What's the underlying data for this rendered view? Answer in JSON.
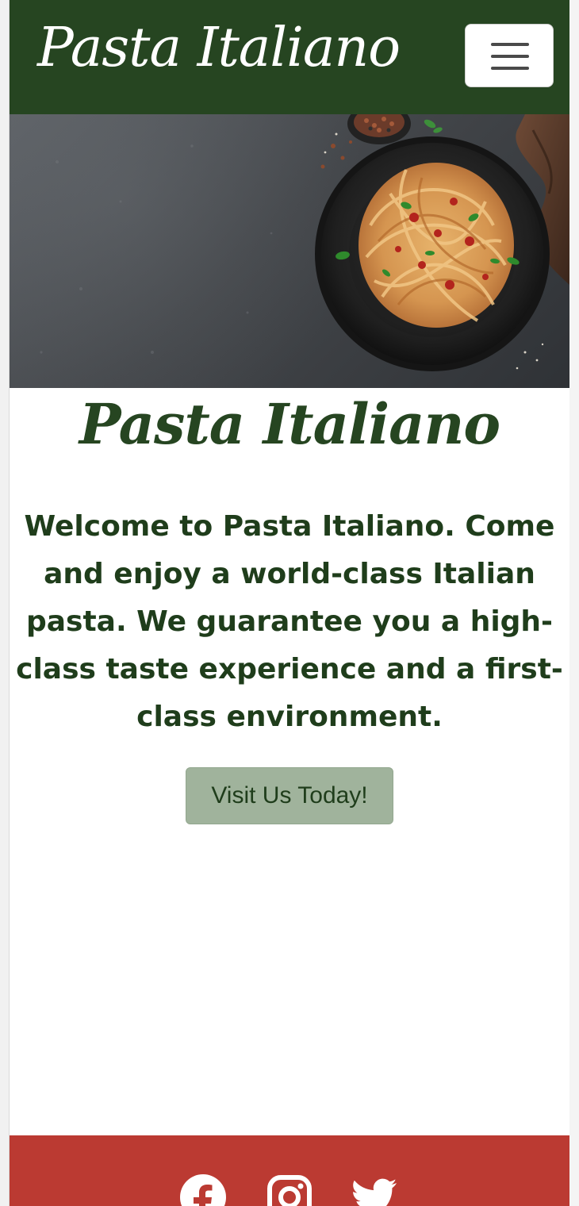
{
  "colors": {
    "navbar_bg": "#264521",
    "accent_green": "#264521",
    "button_bg": "#a0b39c",
    "footer_bg": "#bb3a32"
  },
  "navbar": {
    "brand": "Pasta Italiano",
    "toggler_icon": "hamburger-menu-icon"
  },
  "hero": {
    "image": "plate-of-pasta-photo"
  },
  "main": {
    "title": "Pasta Italiano",
    "welcome_text": "Welcome to Pasta Italiano. Come and enjoy a world-class Italian pasta. We guarantee you a high-class taste experience and a first-class environment.",
    "cta_label": "Visit Us Today!"
  },
  "footer": {
    "social_icons": [
      "facebook-icon",
      "instagram-icon",
      "twitter-icon"
    ]
  }
}
